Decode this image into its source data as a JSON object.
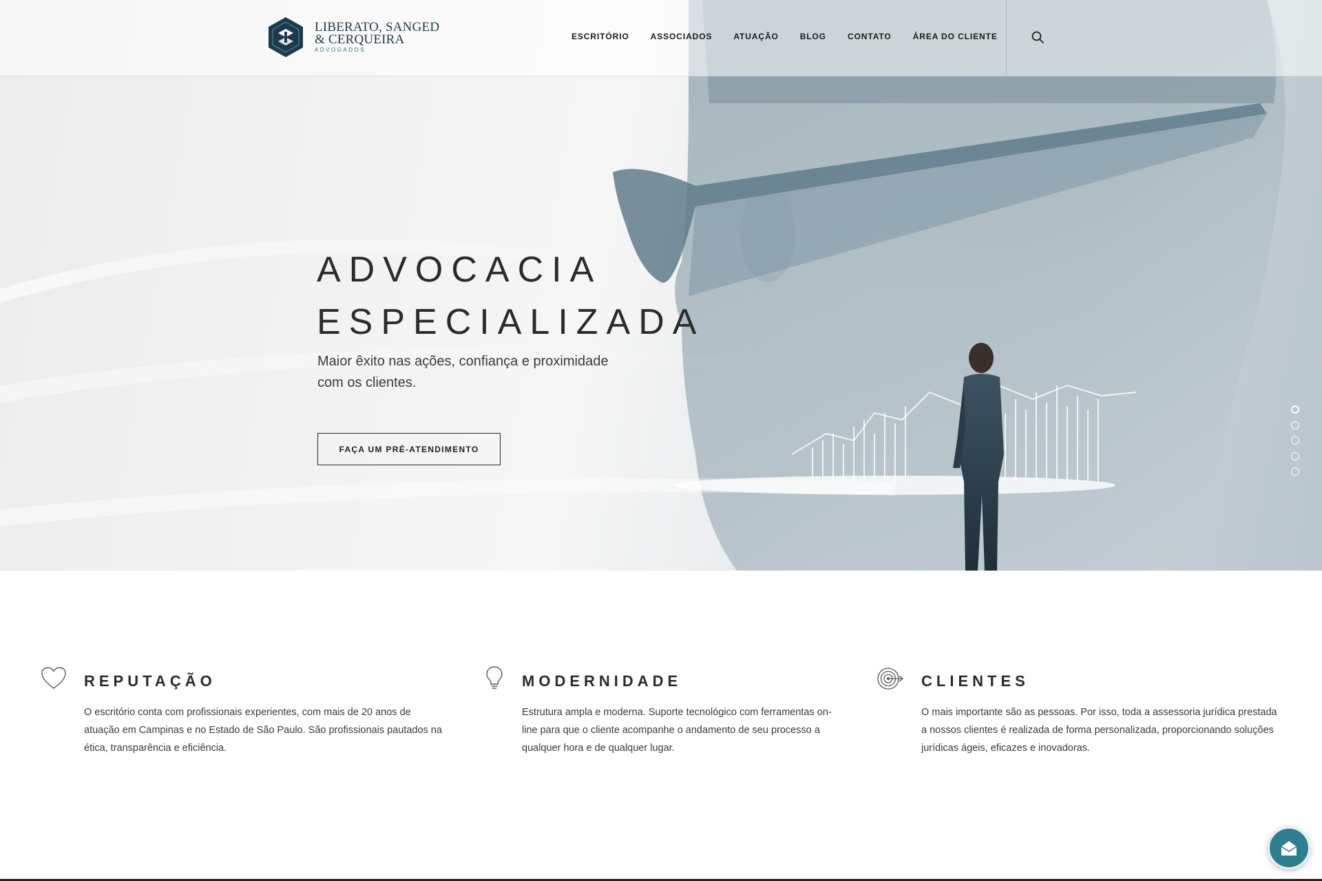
{
  "brand": {
    "name_line1": "LIBERATO, SANGED",
    "name_line2": "& CERQUEIRA",
    "tagline": "ADVOGADOS",
    "color": "#1e3a4a",
    "accent": "#2a6e7e"
  },
  "nav": {
    "items": [
      {
        "label": "ESCRITÓRIO"
      },
      {
        "label": "ASSOCIADOS"
      },
      {
        "label": "ATUAÇÃO"
      },
      {
        "label": "BLOG"
      },
      {
        "label": "CONTATO"
      },
      {
        "label": "ÁREA DO CLIENTE"
      }
    ],
    "search_icon": "search-icon"
  },
  "hero": {
    "title_line1": "ADVOCACIA",
    "title_line2": "ESPECIALIZADA",
    "subtitle": "Maior êxito nas ações, confiança e proximidade com os clientes.",
    "cta_label": "FAÇA UM PRÉ-ATENDIMENTO",
    "slides": 5,
    "active_slide": 1
  },
  "features": [
    {
      "icon": "heart-icon",
      "title": "REPUTAÇÃO",
      "text": "O escritório conta com profissionais experientes, com mais de 20 anos de atuação em Campinas e no Estado de São Paulo. São profissionais pautados na ética, transparência e eficiência."
    },
    {
      "icon": "lightbulb-icon",
      "title": "MODERNIDADE",
      "text": "Estrutura ampla e moderna. Suporte tecnológico com ferramentas on-line para que o cliente acompanhe o andamento de seu processo a qualquer hora e de qualquer lugar."
    },
    {
      "icon": "target-icon",
      "title": "CLIENTES",
      "text": "O mais importante são as pessoas. Por isso, toda a assessoria jurídica prestada a nossos clientes é realizada de forma personalizada, proporcionando soluções jurídicas ágeis, eficazes e inovadoras."
    }
  ],
  "chat": {
    "icon": "mail-icon",
    "color": "#2d7f90"
  }
}
